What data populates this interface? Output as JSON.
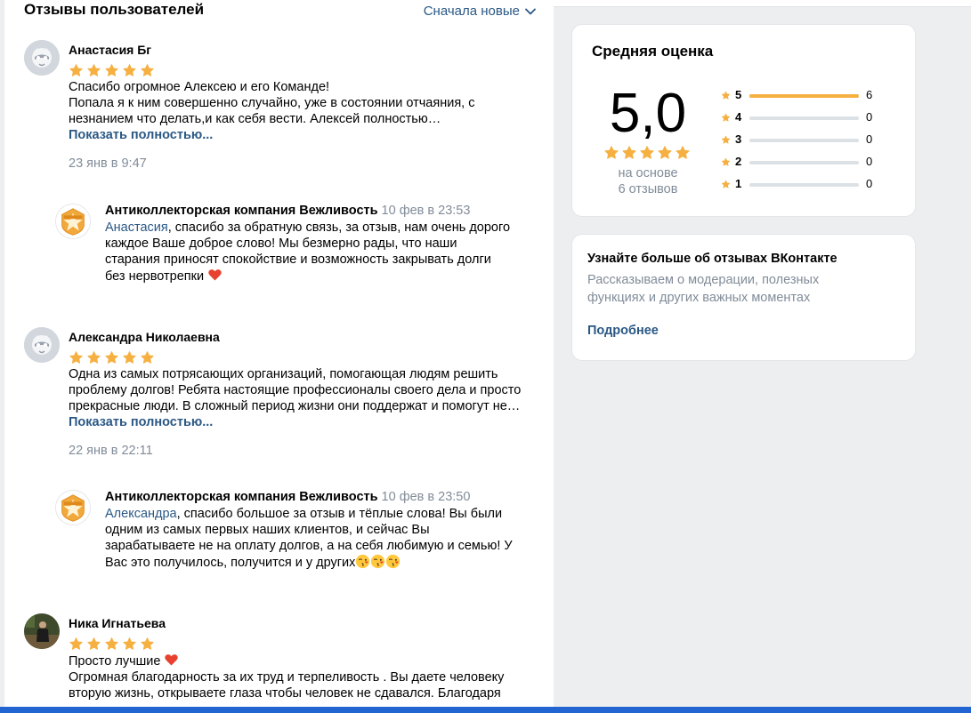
{
  "header": {
    "title": "Отзывы пользователей",
    "sort_label": "Сначала новые"
  },
  "reviews": [
    {
      "name": "Анастасия Бг",
      "rating": 5,
      "text": [
        "Спасибо огромное Алексею и его Команде!",
        "Попала я к ним совершенно случайно, уже в состоянии отчаяния, с",
        "незнанием что делать,и как себя вести. Алексей полностью…"
      ],
      "show_more": "Показать полностью...",
      "date": "23 янв в 9:47",
      "reply": {
        "author": "Антиколлекторская компания Вежливость",
        "date": "10 фев в 23:53",
        "mention": "Анастасия",
        "text_first": ", спасибо за обратную связь, за отзыв, нам очень дорого",
        "text": [
          "каждое Ваше доброе слово! Мы безмерно рады, что наши",
          "старания приносят спокойствие и возможность закрывать долги",
          "без нервотрепки"
        ]
      }
    },
    {
      "name": "Александра Николаевна",
      "rating": 5,
      "text": [
        "Одна из самых потрясающих организаций, помогающая людям решить",
        "проблему долгов! Ребята настоящие профессионалы своего дела и просто",
        "прекрасные люди. В сложный период жизни они поддержат и помогут не…"
      ],
      "show_more": "Показать полностью...",
      "date": "22 янв в 22:11",
      "reply": {
        "author": "Антиколлекторская компания Вежливость",
        "date": "10 фев в 23:50",
        "mention": "Александра",
        "text_first": ", спасибо большое за отзыв и тёплые слова! Вы были",
        "text": [
          "одним из самых первых наших клиентов, и сейчас Вы",
          "зарабатываете не на оплату долгов, а на себя любимую и семью! У",
          "Вас это получилось, получится и у других"
        ]
      }
    },
    {
      "name": "Ника Игнатьева",
      "rating": 5,
      "text": [
        "Просто лучшие",
        "Огромная благодарность за их труд и терпеливость . Вы даете человеку",
        "вторую жизнь, открываете глаза чтобы человек не сдавался. Благодаря"
      ]
    }
  ],
  "rating_card": {
    "title": "Средняя оценка",
    "score": "5,0",
    "based_on_1": "на основе",
    "based_on_2": "6 отзывов",
    "distribution": [
      {
        "stars": "5",
        "count": "6",
        "fraction": 1.0
      },
      {
        "stars": "4",
        "count": "0",
        "fraction": 0
      },
      {
        "stars": "3",
        "count": "0",
        "fraction": 0
      },
      {
        "stars": "2",
        "count": "0",
        "fraction": 0
      },
      {
        "stars": "1",
        "count": "0",
        "fraction": 0
      }
    ]
  },
  "info_card": {
    "title": "Узнайте больше об отзывах ВКонтакте",
    "text_1": "Рассказываем о модерации, полезных",
    "text_2": "функциях и других важных моментах",
    "link": "Подробнее"
  },
  "colors": {
    "star": "#f5b041",
    "link": "#2a5885",
    "muted": "#818c99",
    "accent_bar": "#2264d1"
  }
}
